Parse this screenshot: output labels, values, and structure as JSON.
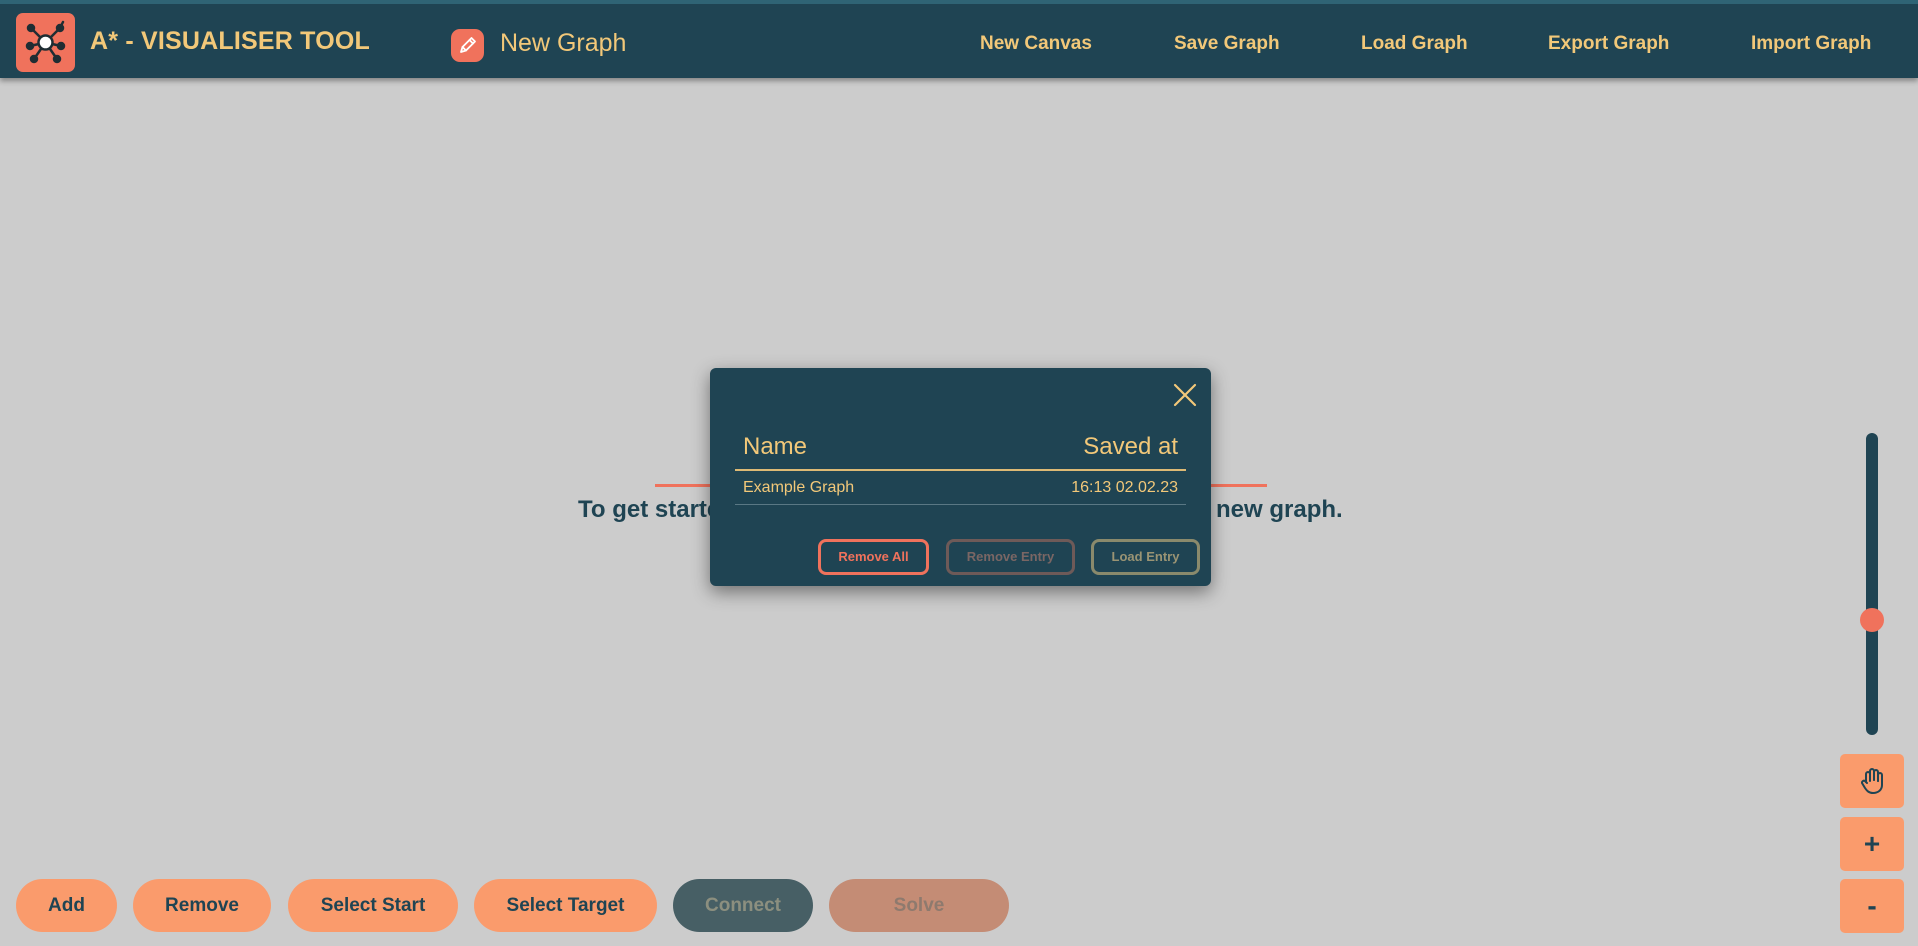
{
  "header": {
    "app_title": "A* - VISUALISER TOOL",
    "graph_name": "New Graph",
    "nav": [
      {
        "label": "New Canvas"
      },
      {
        "label": "Save Graph"
      },
      {
        "label": "Load Graph"
      },
      {
        "label": "Export Graph"
      },
      {
        "label": "Import Graph"
      }
    ]
  },
  "canvas": {
    "hint_text": "To get started, open a saved graph or create a new graph.",
    "hint_visible_left": "To get starte",
    "hint_visible_right": "new graph."
  },
  "load_dialog": {
    "columns": {
      "name": "Name",
      "saved_at": "Saved at"
    },
    "entries": [
      {
        "name": "Example Graph",
        "saved_at": "16:13 02.02.23"
      }
    ],
    "buttons": {
      "remove_all": "Remove All",
      "remove_entry": "Remove Entry",
      "load_entry": "Load Entry"
    }
  },
  "toolbar": {
    "add": "Add",
    "remove": "Remove",
    "select_start": "Select Start",
    "select_target": "Select Target",
    "connect": "Connect",
    "solve": "Solve"
  },
  "zoom": {
    "level_fraction": 0.63,
    "pan_icon": "hand-icon",
    "zoom_in": "+",
    "zoom_out": "-"
  },
  "colors": {
    "header_bg": "#1f4453",
    "accent_text": "#f2c879",
    "brand_coral": "#f0725c",
    "button_orange": "#fa9b6c",
    "canvas_bg": "#cccccc"
  }
}
